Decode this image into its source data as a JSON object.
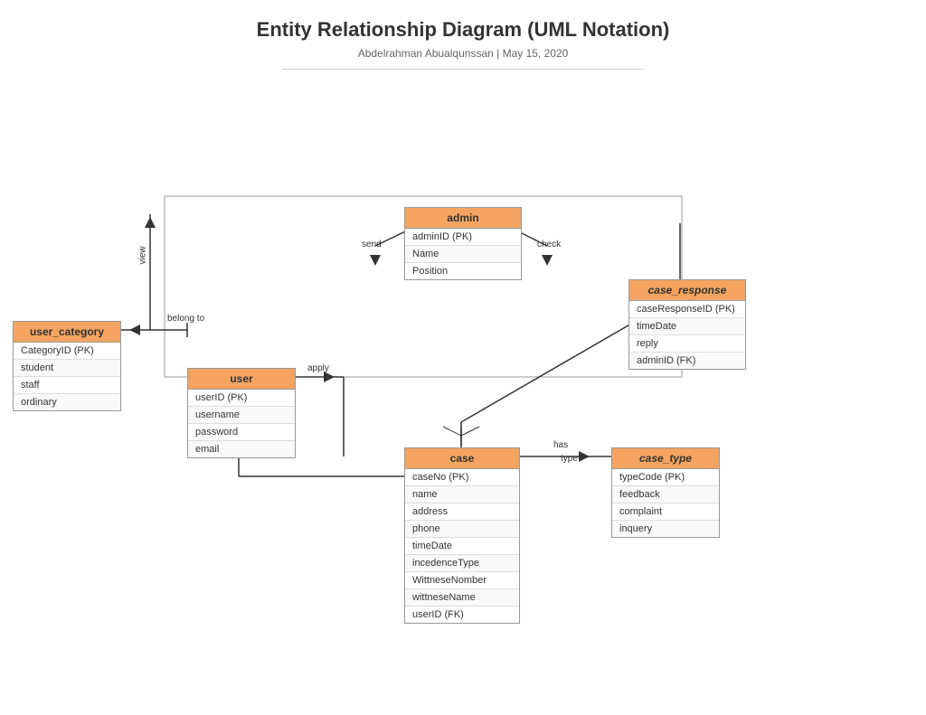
{
  "title": "Entity Relationship Diagram (UML Notation)",
  "subtitle": "Abdelrahman Abualqunssan  |  May 15, 2020",
  "entities": {
    "user_category": {
      "name": "user_category",
      "fields": [
        "CategoryID (PK)",
        "student",
        "staff",
        "ordinary"
      ]
    },
    "user": {
      "name": "user",
      "fields": [
        "userID (PK)",
        "username",
        "password",
        "email"
      ]
    },
    "admin": {
      "name": "admin",
      "fields": [
        "adminID  (PK)",
        "Name",
        "Position"
      ]
    },
    "case": {
      "name": "case",
      "fields": [
        "caseNo  (PK)",
        "name",
        "address",
        "phone",
        "timeDate",
        "incedenceType",
        "WittneseNomber",
        "wittneseName",
        "userID (FK)"
      ]
    },
    "case_response": {
      "name": "case_response",
      "fields": [
        "caseResponseID  (PK)",
        "timeDate",
        "reply",
        "adminID (FK)"
      ]
    },
    "case_type": {
      "name": "case_type",
      "fields": [
        "typeCode (PK)",
        "feedback",
        "complaint",
        "inquery"
      ]
    }
  },
  "relationships": {
    "belong_to": "belong to",
    "apply": "apply",
    "send": "send",
    "check": "check",
    "has": "has",
    "type": "type"
  }
}
